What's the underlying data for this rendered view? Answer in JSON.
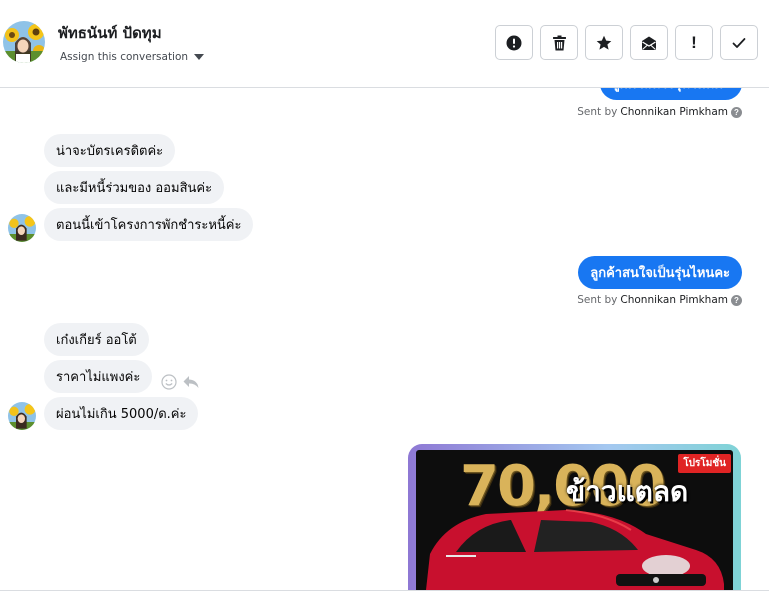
{
  "header": {
    "contact_name": "พัทธนันท์ ปัดทุม",
    "assign_label": "Assign this conversation",
    "toolbar": [
      {
        "name": "spam-button",
        "icon": "alert-circle-icon"
      },
      {
        "name": "delete-button",
        "icon": "trash-icon"
      },
      {
        "name": "star-button",
        "icon": "star-icon"
      },
      {
        "name": "mark-unread-button",
        "icon": "envelope-icon"
      },
      {
        "name": "follow-up-button",
        "icon": "exclamation-icon"
      },
      {
        "name": "mark-done-button",
        "icon": "checkmark-icon"
      }
    ],
    "follow_up_glyph": "!"
  },
  "messages": {
    "out_top_partial": "ลูกค้าสนใจรุ่นไหนคะ",
    "sent_by_prefix": "Sent by",
    "sent_by_name": "Chonnikan Pimkham",
    "info_glyph": "?",
    "in_group_1": [
      "น่าจะบัตรเครดิตค่ะ",
      "และมีหนี้ร่วมของ ออมสินค่ะ",
      "ตอนนี้เข้าโครงการพักชำระหนี้ค่ะ"
    ],
    "out_middle": "ลูกค้าสนใจเป็นรุ่นไหนคะ",
    "in_group_2": [
      "เก๋งเกียร์ ออโต้",
      "ราคาไม่แพงค่ะ",
      "ผ่อนไม่เกิน 5000/ด.ค่ะ"
    ],
    "image_card": {
      "price_text": "70,000",
      "tag_text": "ข้าวแตลด",
      "promo_text": "โปรโมชั่น"
    }
  },
  "colors": {
    "outgoing_bubble": "#1877f2",
    "incoming_bubble": "#f0f2f5"
  }
}
